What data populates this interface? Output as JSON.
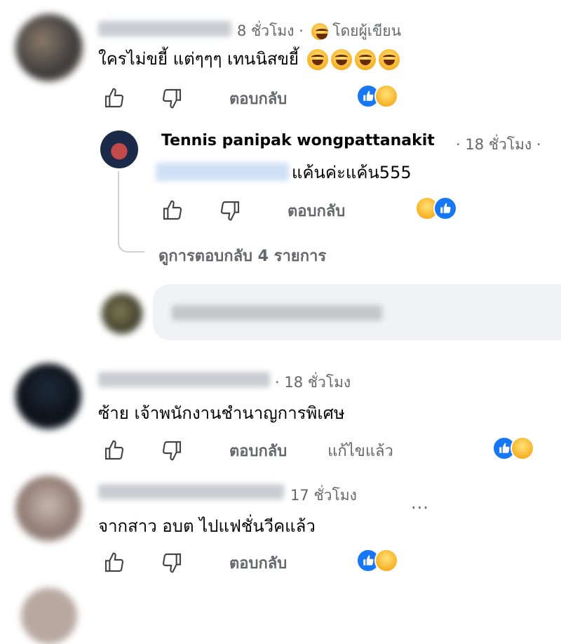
{
  "colors": {
    "accent": "#1877f2",
    "meta": "#65676b",
    "text": "#050505"
  },
  "comments": [
    {
      "time": "8 ชั่วโมง",
      "dot": "·",
      "author_badge": "โดยผู้เขียน",
      "text": "ใครไม่ขยี้ แต่ๆๆๆ เทนนิสขยี้",
      "reply_label": "ตอบกลับ",
      "reactions": [
        "like",
        "haha"
      ]
    },
    {
      "author": "Tennis panipak wongpattanakit",
      "time": "· 18 ชั่วโมง ·",
      "text": "แค้นค่ะแค้น555",
      "reply_label": "ตอบกลับ",
      "reactions": [
        "haha",
        "like"
      ],
      "view_replies": "ดูการตอบกลับ 4 รายการ"
    },
    {
      "time": "· 18 ชั่วโมง",
      "text": "ซ้าย เจ้าพนักงานชำนาญการพิเศษ",
      "reply_label": "ตอบกลับ",
      "edited_label": "แก้ไขแล้ว",
      "reactions": [
        "like",
        "haha"
      ]
    },
    {
      "time": "17 ชั่วโมง",
      "text": "จากสาว อบต ไปแฟชั่นวีคแล้ว",
      "more": "···",
      "reply_label": "ตอบกลับ",
      "reactions": [
        "like",
        "haha"
      ]
    }
  ]
}
